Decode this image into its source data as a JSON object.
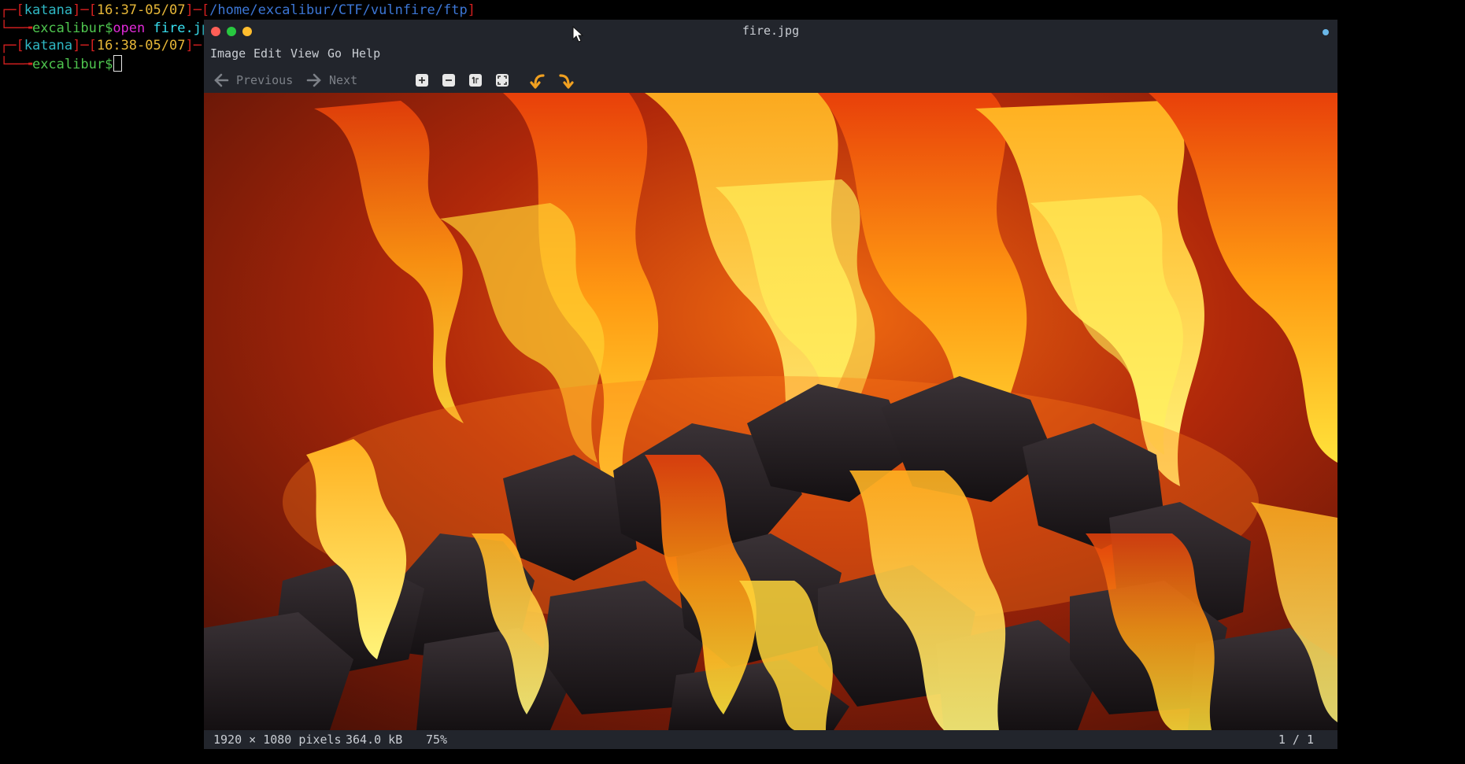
{
  "terminal": {
    "line1": {
      "br_open": "┌─[",
      "user": "katana",
      "sep1": "]─[",
      "time": "16:37-05/07",
      "sep2": "]─[",
      "path": "/home/excalibur/CTF/vulnfire/ftp",
      "br_close": "]"
    },
    "line2": {
      "prefix": "└──╼",
      "prompt": "excalibur$",
      "cmd": "open",
      "arg": "fire.jpg"
    },
    "line3": {
      "br_open": "┌─[",
      "user": "katana",
      "sep1": "]─[",
      "time": "16:38-05/07",
      "sep2": "]─[",
      "path": "/"
    },
    "line4": {
      "prefix": "└──╼",
      "prompt": "excalibur$"
    }
  },
  "window": {
    "title": "fire.jpg",
    "menu": [
      "Image",
      "Edit",
      "View",
      "Go",
      "Help"
    ],
    "toolbar": {
      "previous_label": "Previous",
      "next_label": "Next",
      "icons": [
        "zoom-in-icon",
        "zoom-out-icon",
        "normal-size-icon",
        "best-fit-icon",
        "rotate-left-icon",
        "rotate-right-icon"
      ]
    },
    "status": {
      "dimensions": "1920 × 1080 pixels",
      "size": "364.0 kB",
      "zoom": "75%",
      "position": "1 / 1"
    }
  },
  "colors": {
    "terminal_bg": "#000000",
    "window_bg": "#22252c",
    "accent_orange": "#f0a020",
    "close": "#ff5f57",
    "minimize": "#28c840",
    "maximize": "#ffbd2e"
  }
}
